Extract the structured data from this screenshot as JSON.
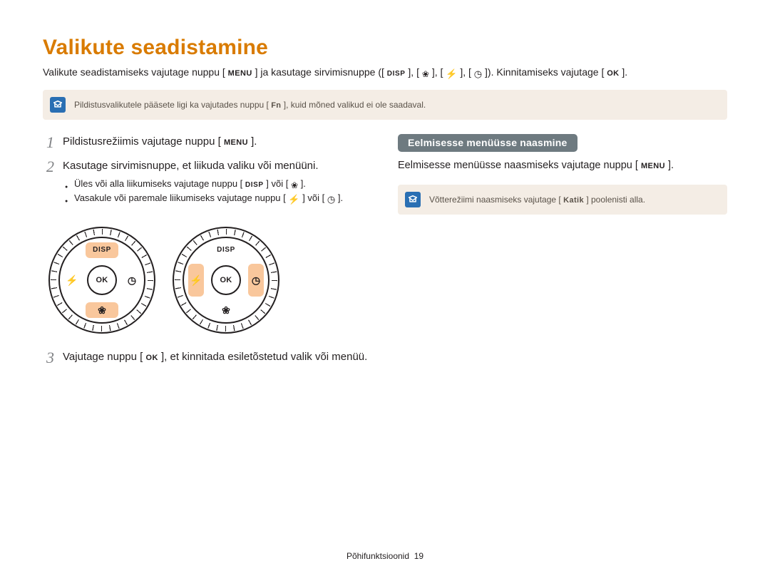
{
  "title": "Valikute seadistamine",
  "intro": {
    "part1": "Valikute seadistamiseks vajutage nuppu [",
    "menu": "MENU",
    "part2": "] ja kasutage sirvimisnuppe ([",
    "disp": "DISP",
    "part3": "], [",
    "part4": "], [",
    "part5": "], [",
    "part6": "]). Kinnitamiseks vajutage [",
    "ok": "OK",
    "part7": "]."
  },
  "note1": {
    "pre": "Pildistusvalikutele pääsete ligi ka vajutades nuppu [",
    "fn": "Fn",
    "post": "], kuid mõned valikud ei ole saadaval."
  },
  "left": {
    "steps": [
      {
        "num": "1",
        "pre": "Pildistusrežiimis vajutage nuppu [",
        "menu": "MENU",
        "post": "]."
      },
      {
        "num": "2",
        "text": "Kasutage sirvimisnuppe, et liikuda valiku või menüüni."
      },
      {
        "num": "3",
        "pre": "Vajutage nuppu [",
        "ok": "OK",
        "post": "], et kinnitada esiletõstetud valik või menüü."
      }
    ],
    "bullets": [
      {
        "pre": "Üles või alla liikumiseks vajutage nuppu [",
        "disp": "DISP",
        "mid": "] või [",
        "post": "]."
      },
      {
        "pre": "Vasakule või paremale liikumiseks vajutage nuppu [",
        "mid": "] või [",
        "post": "]."
      }
    ],
    "dial": {
      "disp": "DISP",
      "ok": "OK"
    }
  },
  "right": {
    "heading": "Eelmisesse menüüsse naasmine",
    "text_pre": "Eelmisesse menüüsse naasmiseks vajutage nuppu [",
    "menu": "MENU",
    "text_post": "].",
    "note": {
      "pre": "Võtterežiimi naasmiseks vajutage [",
      "katik": "Katik",
      "post": "] poolenisti alla."
    }
  },
  "footer": {
    "label": "Põhifunktsioonid",
    "page": "19"
  }
}
